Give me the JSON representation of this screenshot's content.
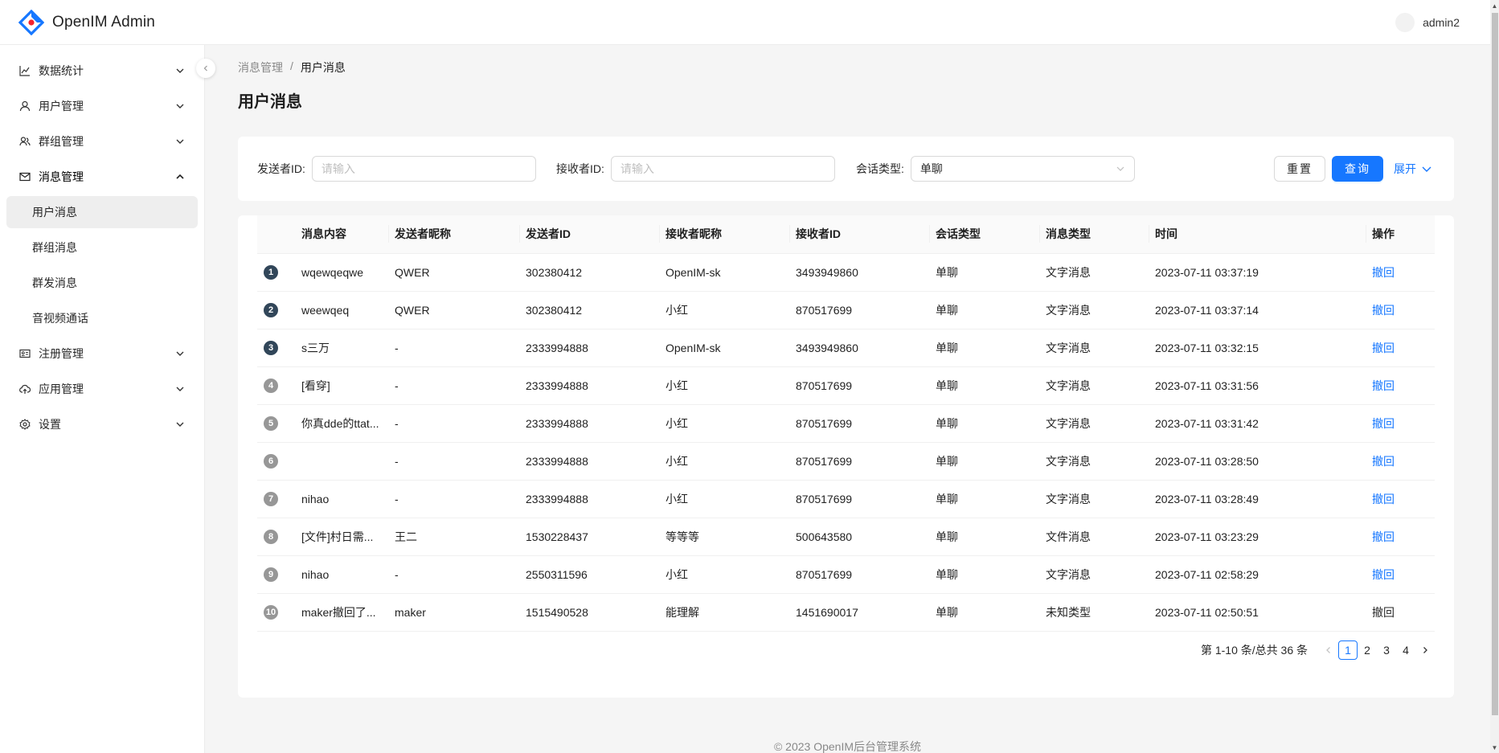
{
  "app": {
    "title": "OpenIM Admin",
    "username": "admin2"
  },
  "sidebar": {
    "items": [
      {
        "label": "数据统计",
        "icon": "line-chart-icon",
        "expanded": false
      },
      {
        "label": "用户管理",
        "icon": "user-icon",
        "expanded": false
      },
      {
        "label": "群组管理",
        "icon": "team-icon",
        "expanded": false
      },
      {
        "label": "消息管理",
        "icon": "mail-icon",
        "expanded": true,
        "children": [
          {
            "label": "用户消息",
            "active": true
          },
          {
            "label": "群组消息"
          },
          {
            "label": "群发消息"
          },
          {
            "label": "音视频通话"
          }
        ]
      },
      {
        "label": "注册管理",
        "icon": "idcard-icon",
        "expanded": false
      },
      {
        "label": "应用管理",
        "icon": "cloud-upload-icon",
        "expanded": false
      },
      {
        "label": "设置",
        "icon": "setting-icon",
        "expanded": false
      }
    ]
  },
  "breadcrumb": {
    "parent": "消息管理",
    "separator": "/",
    "current": "用户消息"
  },
  "page_title": "用户消息",
  "search": {
    "sender_label": "发送者ID:",
    "sender_placeholder": "请输入",
    "receiver_label": "接收者ID:",
    "receiver_placeholder": "请输入",
    "session_label": "会话类型:",
    "session_value": "单聊",
    "reset_label": "重置",
    "query_label": "查询",
    "expand_label": "展开"
  },
  "table": {
    "columns": [
      "",
      "消息内容",
      "发送者昵称",
      "发送者ID",
      "接收者昵称",
      "接收者ID",
      "会话类型",
      "消息类型",
      "时间",
      "操作"
    ],
    "rows": [
      {
        "index": "1",
        "content": "wqewqeqwe",
        "sender_nick": "QWER",
        "sender_id": "302380412",
        "receiver_nick": "OpenIM-sk",
        "receiver_id": "3493949860",
        "session": "单聊",
        "msg_type": "文字消息",
        "time": "2023-07-11 03:37:19",
        "action": "撤回"
      },
      {
        "index": "2",
        "content": "weewqeq",
        "sender_nick": "QWER",
        "sender_id": "302380412",
        "receiver_nick": "小红",
        "receiver_id": "870517699",
        "session": "单聊",
        "msg_type": "文字消息",
        "time": "2023-07-11 03:37:14",
        "action": "撤回"
      },
      {
        "index": "3",
        "content": "s三万",
        "sender_nick": "-",
        "sender_id": "2333994888",
        "receiver_nick": "OpenIM-sk",
        "receiver_id": "3493949860",
        "session": "单聊",
        "msg_type": "文字消息",
        "time": "2023-07-11 03:32:15",
        "action": "撤回"
      },
      {
        "index": "4",
        "content": "[看穿]",
        "sender_nick": "-",
        "sender_id": "2333994888",
        "receiver_nick": "小红",
        "receiver_id": "870517699",
        "session": "单聊",
        "msg_type": "文字消息",
        "time": "2023-07-11 03:31:56",
        "action": "撤回"
      },
      {
        "index": "5",
        "content": "你真dde的ttat...",
        "sender_nick": "-",
        "sender_id": "2333994888",
        "receiver_nick": "小红",
        "receiver_id": "870517699",
        "session": "单聊",
        "msg_type": "文字消息",
        "time": "2023-07-11 03:31:42",
        "action": "撤回"
      },
      {
        "index": "6",
        "content": "",
        "sender_nick": "-",
        "sender_id": "2333994888",
        "receiver_nick": "小红",
        "receiver_id": "870517699",
        "session": "单聊",
        "msg_type": "文字消息",
        "time": "2023-07-11 03:28:50",
        "action": "撤回"
      },
      {
        "index": "7",
        "content": "nihao",
        "sender_nick": "-",
        "sender_id": "2333994888",
        "receiver_nick": "小红",
        "receiver_id": "870517699",
        "session": "单聊",
        "msg_type": "文字消息",
        "time": "2023-07-11 03:28:49",
        "action": "撤回"
      },
      {
        "index": "8",
        "content": "[文件]村日需...",
        "sender_nick": "王二",
        "sender_id": "1530228437",
        "receiver_nick": "等等等",
        "receiver_id": "500643580",
        "session": "单聊",
        "msg_type": "文件消息",
        "time": "2023-07-11 03:23:29",
        "action": "撤回"
      },
      {
        "index": "9",
        "content": "nihao",
        "sender_nick": "-",
        "sender_id": "2550311596",
        "receiver_nick": "小红",
        "receiver_id": "870517699",
        "session": "单聊",
        "msg_type": "文字消息",
        "time": "2023-07-11 02:58:29",
        "action": "撤回"
      },
      {
        "index": "10",
        "content": "maker撤回了...",
        "sender_nick": "maker",
        "sender_id": "1515490528",
        "receiver_nick": "能理解",
        "receiver_id": "1451690017",
        "session": "单聊",
        "msg_type": "未知类型",
        "time": "2023-07-11 02:50:51",
        "action": "撤回"
      }
    ]
  },
  "pagination": {
    "total_text": "第 1-10 条/总共 36 条",
    "pages": [
      "1",
      "2",
      "3",
      "4"
    ],
    "current": "1"
  },
  "footer": "© 2023 OpenIM后台管理系统",
  "colors": {
    "primary": "#1677ff",
    "index_dark": "#314659",
    "index_grey": "#979797"
  }
}
